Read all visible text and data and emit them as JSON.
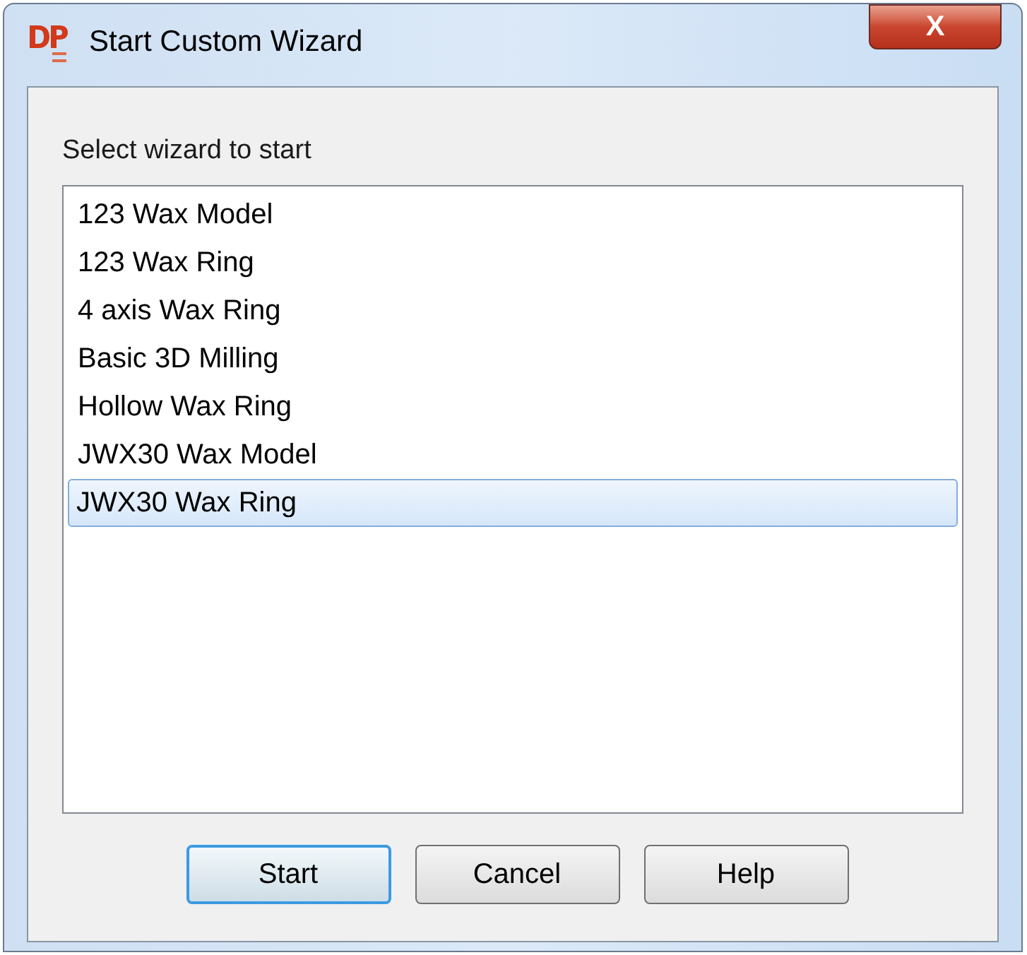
{
  "window": {
    "title": "Start Custom Wizard",
    "close_label": "X"
  },
  "prompt": "Select wizard to start",
  "wizards": [
    {
      "label": "123 Wax Model",
      "selected": false
    },
    {
      "label": "123 Wax Ring",
      "selected": false
    },
    {
      "label": "4 axis Wax Ring",
      "selected": false
    },
    {
      "label": "Basic 3D Milling",
      "selected": false
    },
    {
      "label": "Hollow Wax Ring",
      "selected": false
    },
    {
      "label": "JWX30 Wax Model",
      "selected": false
    },
    {
      "label": "JWX30 Wax Ring",
      "selected": true
    }
  ],
  "buttons": [
    {
      "label": "Start",
      "default": true
    },
    {
      "label": "Cancel",
      "default": false
    },
    {
      "label": "Help",
      "default": false
    }
  ]
}
